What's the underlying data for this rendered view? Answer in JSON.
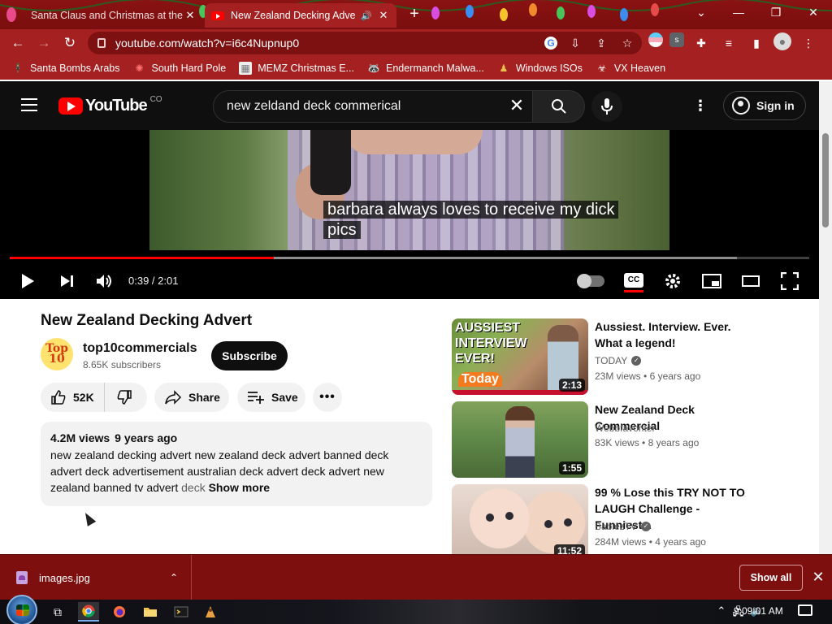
{
  "browser": {
    "tabs": [
      {
        "title": "Santa Claus and Christmas at the",
        "active": false
      },
      {
        "title": "New Zealand Decking Adver",
        "active": true,
        "audio": true
      }
    ],
    "new_tab": "+",
    "url_domain": "youtube.com",
    "url_path": "/watch?v=i6c4Nupnup0",
    "bookmarks": [
      {
        "label": "Santa Bombs Arabs",
        "icon": "person-icon"
      },
      {
        "label": "South Hard Pole",
        "icon": "snowflake-icon"
      },
      {
        "label": "MEMZ Christmas E...",
        "icon": "image-icon"
      },
      {
        "label": "Endermanch Malwa...",
        "icon": "raccoon-icon"
      },
      {
        "label": "Windows ISOs",
        "icon": "figure-icon"
      },
      {
        "label": "VX Heaven",
        "icon": "biohazard-icon"
      }
    ]
  },
  "youtube": {
    "logo_word": "YouTube",
    "country_code": "CO",
    "search_value": "new zeldand deck commerical",
    "sign_in": "Sign in"
  },
  "player": {
    "caption_line1": "barbara always loves to receive my dick",
    "caption_line2": "pics",
    "time": "0:39 / 2:01",
    "played_fraction": 0.33,
    "buffered_fraction": 0.91
  },
  "video": {
    "title": "New Zealand Decking Advert",
    "channel": "top10commercials",
    "avatar_text_1": "Top",
    "avatar_text_2": "10",
    "subscribers": "8.65K subscribers",
    "subscribe": "Subscribe",
    "likes": "52K",
    "share": "Share",
    "save": "Save",
    "views": "4.2M views",
    "age": "9 years ago",
    "description_a": "new zealand decking advert new zealand deck advert banned deck advert deck advertisement australian deck advert deck advert new zealand banned tv advert ",
    "description_fade": "deck",
    "show_more": "Show more"
  },
  "related": [
    {
      "title": "Aussiest. Interview. Ever. What a legend!",
      "channel": "TODAY",
      "verified": true,
      "views": "23M views",
      "age": "6 years ago",
      "duration": "2:13",
      "thumb_text_1": "AUSSIEST",
      "thumb_text_2": "INTERVIEW",
      "thumb_text_3": "EVER!",
      "thumb_logo": "Today"
    },
    {
      "title": "New Zealand Deck Commercial",
      "channel": "Webbfavoriter",
      "verified": false,
      "views": "83K views",
      "age": "8 years ago",
      "duration": "1:55"
    },
    {
      "title": "99 % Lose this TRY NOT TO LAUGH Challenge - Funniest...",
      "channel": "BabiezTV",
      "verified": true,
      "views": "284M views",
      "age": "4 years ago",
      "duration": "11:52"
    }
  ],
  "downloads": {
    "file": "images.jpg",
    "show_all": "Show all"
  },
  "taskbar": {
    "clock": "9:09:01 AM"
  },
  "colors": {
    "chrome_theme": "#a52020",
    "yt_red": "#ff0000",
    "yt_bg": "#0f0f0f"
  }
}
